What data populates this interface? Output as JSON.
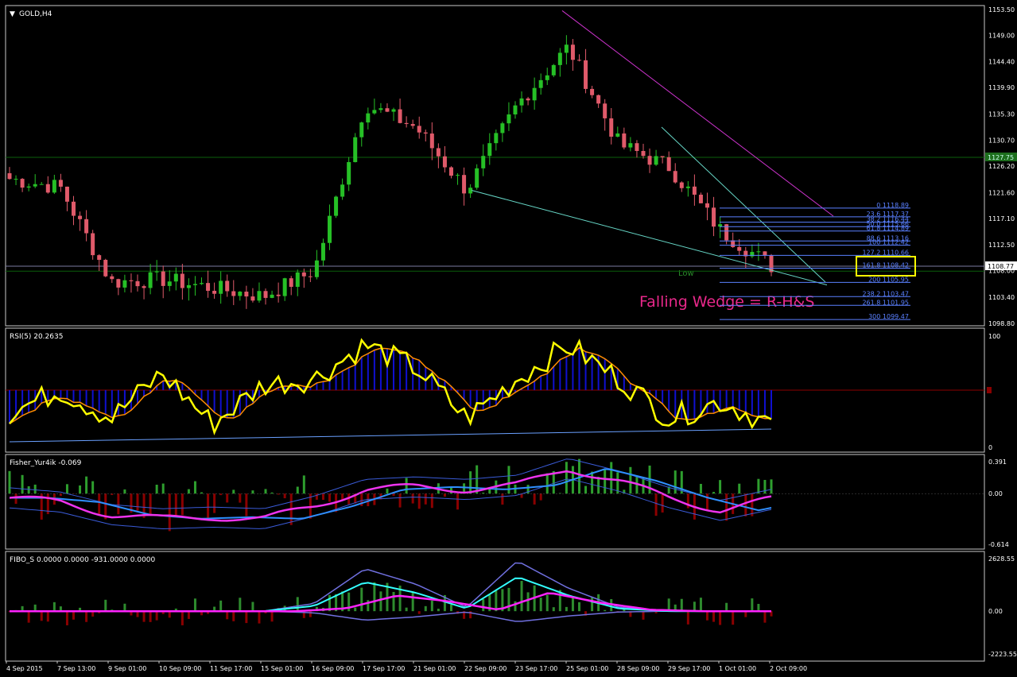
{
  "window": {
    "title": "GOLD,H4",
    "menu_glyph": "▼"
  },
  "colors": {
    "background": "#000000",
    "frame": "#c8c8c8",
    "bull": "#26c026",
    "bear": "#e05a6a",
    "grid": "#0b5f0b",
    "rsi_line": "#ffff00",
    "rsi_ma": "#ff8c00",
    "rsi_hist": "#1010d0",
    "fisher_pos": "#2e9e2e",
    "fisher_neg": "#8b0000",
    "fisher_main": "#ee33ee",
    "fisher_signal": "#2f8fff",
    "fibo_cyan": "#33ffff",
    "fibo_magenta": "#ff22ff",
    "fibo_purple": "#7070e0",
    "annotation": "#e8288a",
    "wedge_upper": "#cc33cc",
    "wedge_lower": "#66d6c6",
    "highlight_box": "#ffff00",
    "fib_levels": "#5a80ff"
  },
  "main_panel": {
    "price_labels": [
      "1153.50",
      "1149.00",
      "1144.40",
      "1139.90",
      "1135.30",
      "1130.70",
      "1126.20",
      "1121.60",
      "1117.10",
      "1112.50",
      "1108.00",
      "1103.40",
      "1098.80"
    ],
    "current_price": "1108.77",
    "highlight_price": "1127.75",
    "highlight_price2": "1107.90",
    "low_label": "Low",
    "annotation": "Falling Wedge = R-H&S",
    "fib_levels": [
      {
        "label": "0 1118.89"
      },
      {
        "label": "23.6 1117.37"
      },
      {
        "label": "38.2 1116.44"
      },
      {
        "label": "50.0 1115.66"
      },
      {
        "label": "61.8 1114.89"
      },
      {
        "label": "88.6 1113.16"
      },
      {
        "label": "100 1112.42"
      },
      {
        "label": "127.2 1110.66"
      },
      {
        "label": "161.8 1108.42"
      },
      {
        "label": "200 1105.95"
      },
      {
        "label": "238.2 1103.47"
      },
      {
        "label": "261.8 1101.95"
      },
      {
        "label": "300 1099.47"
      }
    ]
  },
  "rsi_panel": {
    "title": "RSI(5) 20.2635",
    "scale": [
      "100",
      "0"
    ]
  },
  "fisher_panel": {
    "title": "Fisher_Yur4ik -0.069",
    "scale": [
      "0.391",
      "0.00",
      "-0.614"
    ]
  },
  "fibo_panel": {
    "title": "FIBO_S 0.0000 0.0000 -931.0000 0.0000",
    "scale": [
      "2628.55",
      "0.00",
      "-2223.55"
    ]
  },
  "time_axis": [
    "4 Sep 2015",
    "7 Sep 13:00",
    "9 Sep 01:00",
    "10 Sep 09:00",
    "11 Sep 17:00",
    "15 Sep 01:00",
    "16 Sep 09:00",
    "17 Sep 17:00",
    "21 Sep 01:00",
    "22 Sep 09:00",
    "23 Sep 17:00",
    "25 Sep 01:00",
    "28 Sep 09:00",
    "29 Sep 17:00",
    "1 Oct 01:00",
    "2 Oct 09:00"
  ],
  "chart_data": [
    {
      "type": "candlestick",
      "title": "GOLD,H4",
      "x": [
        "4 Sep 2015",
        "7 Sep 13:00",
        "9 Sep 01:00",
        "10 Sep 09:00",
        "11 Sep 17:00",
        "15 Sep 01:00",
        "16 Sep 09:00",
        "17 Sep 17:00",
        "21 Sep 01:00",
        "22 Sep 09:00",
        "23 Sep 17:00",
        "25 Sep 01:00",
        "28 Sep 09:00",
        "29 Sep 17:00",
        "1 Oct 01:00",
        "2 Oct 09:00"
      ],
      "close_approx": [
        1124.0,
        1122.5,
        1106.0,
        1106.5,
        1105.0,
        1103.5,
        1108.0,
        1137.0,
        1133.0,
        1122.0,
        1137.0,
        1147.0,
        1130.0,
        1126.0,
        1115.0,
        1108.8
      ],
      "ylim": [
        1098.8,
        1153.5
      ]
    },
    {
      "type": "line",
      "title": "RSI(5) 20.2635",
      "values_approx": [
        30,
        50,
        25,
        65,
        20,
        55,
        60,
        90,
        70,
        25,
        60,
        90,
        60,
        25,
        40,
        20
      ],
      "ylim": [
        0,
        100
      ]
    },
    {
      "type": "line",
      "title": "Fisher_Yur4ik -0.069",
      "values_approx": [
        -0.05,
        -0.1,
        -0.25,
        -0.3,
        -0.28,
        -0.3,
        -0.15,
        0.05,
        0.08,
        0.05,
        0.1,
        0.3,
        0.15,
        -0.05,
        -0.2,
        -0.069
      ],
      "ylim": [
        -0.614,
        0.391
      ]
    },
    {
      "type": "line",
      "title": "FIBO_S 0.0000 0.0000 -931.0000 0.0000",
      "values_approx": [
        0,
        0,
        0,
        0,
        0,
        0,
        200,
        1100,
        700,
        100,
        1300,
        600,
        100,
        0,
        0,
        0
      ],
      "ylim": [
        -2223.55,
        2628.55
      ]
    }
  ]
}
